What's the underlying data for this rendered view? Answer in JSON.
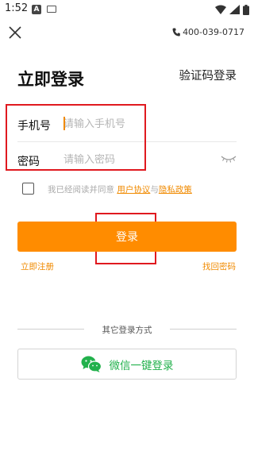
{
  "status_bar": {
    "time": "1:52",
    "notif_letter": "A"
  },
  "header": {
    "phone": "400-039-0717"
  },
  "login": {
    "title": "立即登录",
    "alt_login": "验证码登录",
    "phone_label": "手机号",
    "phone_placeholder": "请输入手机号",
    "password_label": "密码",
    "password_placeholder": "请输入密码"
  },
  "agreement": {
    "prefix": "我已经阅读并同意",
    "user_agreement": "用户协议",
    "and": "与",
    "privacy_policy": "隐私政策"
  },
  "actions": {
    "login_button": "登录",
    "register": "立即注册",
    "forgot_password": "找回密码"
  },
  "other_login": {
    "divider_text": "其它登录方式",
    "wechat_button": "微信一键登录"
  },
  "colors": {
    "accent": "#ff8c00",
    "wechat": "#22b14c",
    "highlight": "#e0191f"
  }
}
